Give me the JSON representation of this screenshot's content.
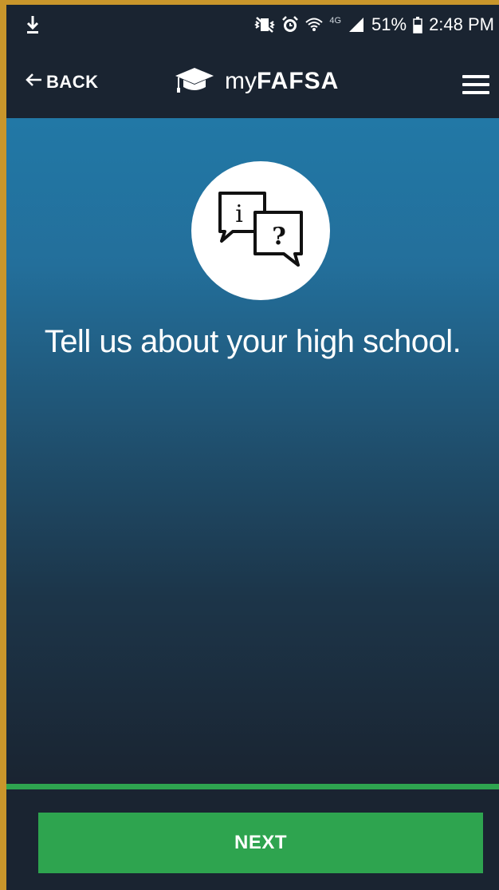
{
  "status_bar": {
    "battery_percent": "51%",
    "time": "2:48 PM",
    "network_label": "4G",
    "icons": [
      "download-icon",
      "vibrate-mute-icon",
      "alarm-icon",
      "wifi-icon",
      "signal-icon",
      "battery-icon"
    ]
  },
  "nav": {
    "back_label": "BACK",
    "logo_light": "my",
    "logo_bold": "FAFSA",
    "logo_icon": "graduation-cap-icon",
    "menu_icon": "hamburger-menu-icon"
  },
  "hero": {
    "icon": "info-question-speech-bubbles-icon",
    "info_glyph": "i",
    "question_glyph": "?",
    "title": "Tell us about your high school."
  },
  "footer": {
    "progress": 1.0,
    "next_label": "NEXT"
  },
  "colors": {
    "background": "#1a2431",
    "hero_top": "#2278a6",
    "accent_green": "#2ea44f",
    "frame_border": "#c9962b"
  }
}
